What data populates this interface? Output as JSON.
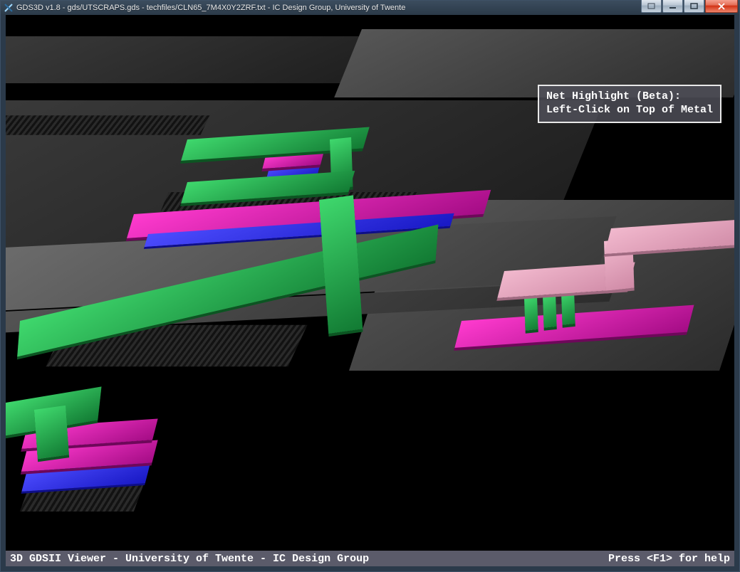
{
  "window": {
    "title": "GDS3D v1.8 - gds/UTSCRAPS.gds - techfiles/CLN65_7M4X0Y2ZRF.txt - IC Design Group, University of Twente"
  },
  "hint": {
    "line1": "Net Highlight (Beta):",
    "line2": "Left-Click on Top of Metal"
  },
  "status": {
    "left": "3D GDSII Viewer - University of Twente - IC Design Group",
    "right": "Press <F1> for help"
  },
  "colors": {
    "metal_green": "#2dbb57",
    "metal_magenta": "#d61fae",
    "metal_blue": "#2a2ae6",
    "metal_pink": "#e3a7bd",
    "chip_gray_dark": "#2c2c2c",
    "chip_gray_mid": "#4a4a4a",
    "chip_gray_light": "#6a6a6a"
  }
}
